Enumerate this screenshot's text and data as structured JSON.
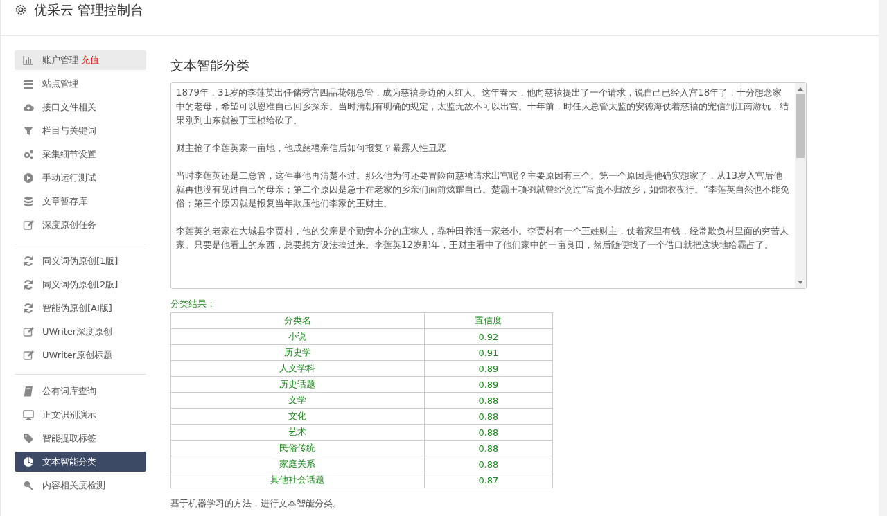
{
  "header": {
    "title": "优采云 管理控制台"
  },
  "sidebar": {
    "groups": [
      {
        "items": [
          {
            "label": "账户管理",
            "badge": "充值",
            "selected": false,
            "hovered": true
          },
          {
            "label": "站点管理",
            "selected": false,
            "hovered": false
          },
          {
            "label": "接口文件相关",
            "selected": false,
            "hovered": false
          },
          {
            "label": "栏目与关键词",
            "selected": false,
            "hovered": false
          },
          {
            "label": "采集细节设置",
            "selected": false,
            "hovered": false
          },
          {
            "label": "手动运行测试",
            "selected": false,
            "hovered": false
          },
          {
            "label": "文章暂存库",
            "selected": false,
            "hovered": false
          },
          {
            "label": "深度原创任务",
            "selected": false,
            "hovered": false
          }
        ]
      },
      {
        "items": [
          {
            "label": "同义词伪原创[1版]",
            "selected": false,
            "hovered": false
          },
          {
            "label": "同义词伪原创[2版]",
            "selected": false,
            "hovered": false
          },
          {
            "label": "智能伪原创[AI版]",
            "selected": false,
            "hovered": false
          },
          {
            "label": "UWriter深度原创",
            "selected": false,
            "hovered": false
          },
          {
            "label": "UWriter原创标题",
            "selected": false,
            "hovered": false
          }
        ]
      },
      {
        "items": [
          {
            "label": "公有词库查询",
            "selected": false,
            "hovered": false
          },
          {
            "label": "正文识别演示",
            "selected": false,
            "hovered": false
          },
          {
            "label": "智能提取标签",
            "selected": false,
            "hovered": false
          },
          {
            "label": "文本智能分类",
            "selected": true,
            "hovered": false
          },
          {
            "label": "内容相关度检测",
            "selected": false,
            "hovered": false
          }
        ]
      }
    ]
  },
  "main": {
    "title": "文本智能分类",
    "article_paragraphs": [
      "1879年，31岁的李莲英出任储秀宫四品花翎总管，成为慈禧身边的大红人。这年春天，他向慈禧提出了一个请求，说自己已经入宫18年了，十分想念家中的老母，希望可以恩准自己回乡探亲。当时清朝有明确的规定，太监无故不可以出宫。十年前，时任大总管太监的安德海仗着慈禧的宠信到江南游玩，结果刚到山东就被丁宝桢给砍了。",
      "财主抢了李莲英家一亩地，他成慈禧亲信后如何报复？暴露人性丑恶",
      "当时李莲英还是二总管，这件事他再清楚不过。那么他为何还要冒险向慈禧请求出宫呢？主要原因有三个。第一个原因是他确实想家了，从13岁入宫后他就再也没有见过自己的母亲；第二个原因是急于在老家的乡亲们面前炫耀自己。楚霸王项羽就曾经说过“富贵不归故乡，如锦衣夜行。”李莲英自然也不能免俗；第三个原因就是报复当年欺压他们李家的王财主。",
      "李莲英的老家在大城县李贾村，他的父亲是个勤劳本分的庄稼人，靠种田养活一家老小。李贾村有一个王姓财主，仗着家里有钱，经常欺负村里面的穷苦人家。只要是他看上的东西，总要想方设法搞过来。李莲英12岁那年，王财主看中了他们家中的一亩良田，然后随便找了一个借口就把这块地给霸占了。"
    ],
    "result_label": "分类结果：",
    "table": {
      "columns": [
        "分类名",
        "置信度"
      ],
      "rows": [
        [
          "小说",
          "0.92"
        ],
        [
          "历史学",
          "0.91"
        ],
        [
          "人文学科",
          "0.89"
        ],
        [
          "历史话题",
          "0.89"
        ],
        [
          "文学",
          "0.88"
        ],
        [
          "文化",
          "0.88"
        ],
        [
          "艺术",
          "0.88"
        ],
        [
          "民俗传统",
          "0.88"
        ],
        [
          "家庭关系",
          "0.88"
        ],
        [
          "其他社会话题",
          "0.87"
        ]
      ]
    },
    "description": "基于机器学习的方法，进行文本智能分类。"
  }
}
